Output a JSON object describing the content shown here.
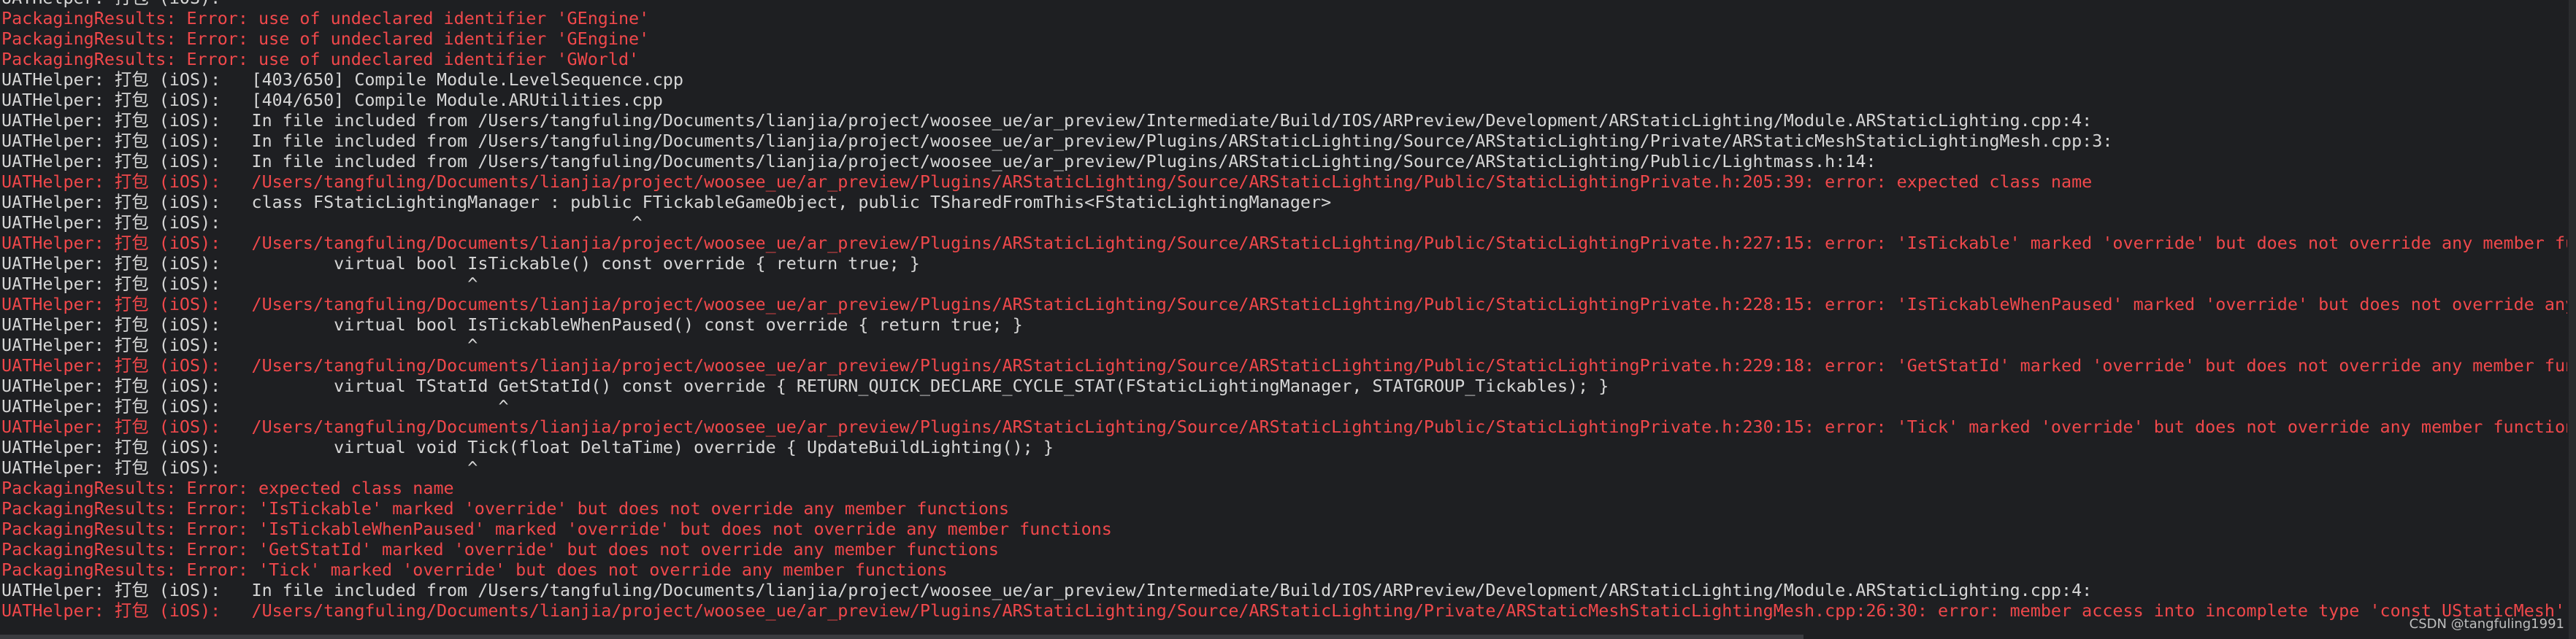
{
  "lines": [
    {
      "text": "UATHelper: 打包 (iOS):",
      "kind": "info"
    },
    {
      "text": "PackagingResults: Error: use of undeclared identifier 'GEngine'",
      "kind": "err"
    },
    {
      "text": "PackagingResults: Error: use of undeclared identifier 'GEngine'",
      "kind": "err"
    },
    {
      "text": "PackagingResults: Error: use of undeclared identifier 'GWorld'",
      "kind": "err"
    },
    {
      "text": "UATHelper: 打包 (iOS):   [403/650] Compile Module.LevelSequence.cpp",
      "kind": "info"
    },
    {
      "text": "UATHelper: 打包 (iOS):   [404/650] Compile Module.ARUtilities.cpp",
      "kind": "info"
    },
    {
      "text": "UATHelper: 打包 (iOS):   In file included from /Users/tangfuling/Documents/lianjia/project/woosee_ue/ar_preview/Intermediate/Build/IOS/ARPreview/Development/ARStaticLighting/Module.ARStaticLighting.cpp:4:",
      "kind": "info"
    },
    {
      "text": "UATHelper: 打包 (iOS):   In file included from /Users/tangfuling/Documents/lianjia/project/woosee_ue/ar_preview/Plugins/ARStaticLighting/Source/ARStaticLighting/Private/ARStaticMeshStaticLightingMesh.cpp:3:",
      "kind": "info"
    },
    {
      "text": "UATHelper: 打包 (iOS):   In file included from /Users/tangfuling/Documents/lianjia/project/woosee_ue/ar_preview/Plugins/ARStaticLighting/Source/ARStaticLighting/Public/Lightmass.h:14:",
      "kind": "info"
    },
    {
      "text": "UATHelper: 打包 (iOS):   /Users/tangfuling/Documents/lianjia/project/woosee_ue/ar_preview/Plugins/ARStaticLighting/Source/ARStaticLighting/Public/StaticLightingPrivate.h:205:39: error: expected class name",
      "kind": "err"
    },
    {
      "text": "UATHelper: 打包 (iOS):   class FStaticLightingManager : public FTickableGameObject, public TSharedFromThis<FStaticLightingManager>",
      "kind": "info"
    },
    {
      "text": "UATHelper: 打包 (iOS):                                        ^",
      "kind": "info"
    },
    {
      "text": "UATHelper: 打包 (iOS):   /Users/tangfuling/Documents/lianjia/project/woosee_ue/ar_preview/Plugins/ARStaticLighting/Source/ARStaticLighting/Public/StaticLightingPrivate.h:227:15: error: 'IsTickable' marked 'override' but does not override any member functions",
      "kind": "err"
    },
    {
      "text": "UATHelper: 打包 (iOS):           virtual bool IsTickable() const override { return true; }",
      "kind": "info"
    },
    {
      "text": "UATHelper: 打包 (iOS):                        ^",
      "kind": "info"
    },
    {
      "text": "UATHelper: 打包 (iOS):   /Users/tangfuling/Documents/lianjia/project/woosee_ue/ar_preview/Plugins/ARStaticLighting/Source/ARStaticLighting/Public/StaticLightingPrivate.h:228:15: error: 'IsTickableWhenPaused' marked 'override' but does not override any member functions",
      "kind": "err"
    },
    {
      "text": "UATHelper: 打包 (iOS):           virtual bool IsTickableWhenPaused() const override { return true; }",
      "kind": "info"
    },
    {
      "text": "UATHelper: 打包 (iOS):                        ^",
      "kind": "info"
    },
    {
      "text": "UATHelper: 打包 (iOS):   /Users/tangfuling/Documents/lianjia/project/woosee_ue/ar_preview/Plugins/ARStaticLighting/Source/ARStaticLighting/Public/StaticLightingPrivate.h:229:18: error: 'GetStatId' marked 'override' but does not override any member functions",
      "kind": "err"
    },
    {
      "text": "UATHelper: 打包 (iOS):           virtual TStatId GetStatId() const override { RETURN_QUICK_DECLARE_CYCLE_STAT(FStaticLightingManager, STATGROUP_Tickables); }",
      "kind": "info"
    },
    {
      "text": "UATHelper: 打包 (iOS):                           ^",
      "kind": "info"
    },
    {
      "text": "UATHelper: 打包 (iOS):   /Users/tangfuling/Documents/lianjia/project/woosee_ue/ar_preview/Plugins/ARStaticLighting/Source/ARStaticLighting/Public/StaticLightingPrivate.h:230:15: error: 'Tick' marked 'override' but does not override any member functions",
      "kind": "err"
    },
    {
      "text": "UATHelper: 打包 (iOS):           virtual void Tick(float DeltaTime) override { UpdateBuildLighting(); }",
      "kind": "info"
    },
    {
      "text": "UATHelper: 打包 (iOS):                        ^",
      "kind": "info"
    },
    {
      "text": "PackagingResults: Error: expected class name",
      "kind": "err"
    },
    {
      "text": "PackagingResults: Error: 'IsTickable' marked 'override' but does not override any member functions",
      "kind": "err"
    },
    {
      "text": "PackagingResults: Error: 'IsTickableWhenPaused' marked 'override' but does not override any member functions",
      "kind": "err"
    },
    {
      "text": "PackagingResults: Error: 'GetStatId' marked 'override' but does not override any member functions",
      "kind": "err"
    },
    {
      "text": "PackagingResults: Error: 'Tick' marked 'override' but does not override any member functions",
      "kind": "err"
    },
    {
      "text": "UATHelper: 打包 (iOS):   In file included from /Users/tangfuling/Documents/lianjia/project/woosee_ue/ar_preview/Intermediate/Build/IOS/ARPreview/Development/ARStaticLighting/Module.ARStaticLighting.cpp:4:",
      "kind": "info"
    },
    {
      "text": "UATHelper: 打包 (iOS):   /Users/tangfuling/Documents/lianjia/project/woosee_ue/ar_preview/Plugins/ARStaticLighting/Source/ARStaticLighting/Private/ARStaticMeshStaticLightingMesh.cpp:26:30: error: member access into incomplete type 'const UStaticMesh'",
      "kind": "err"
    },
    {
      "text": "",
      "kind": "info"
    }
  ],
  "watermark": "CSDN @tangfuling1991",
  "colors": {
    "background": "#1e1f22",
    "error": "#f0484b",
    "info": "#d6d6d6"
  }
}
